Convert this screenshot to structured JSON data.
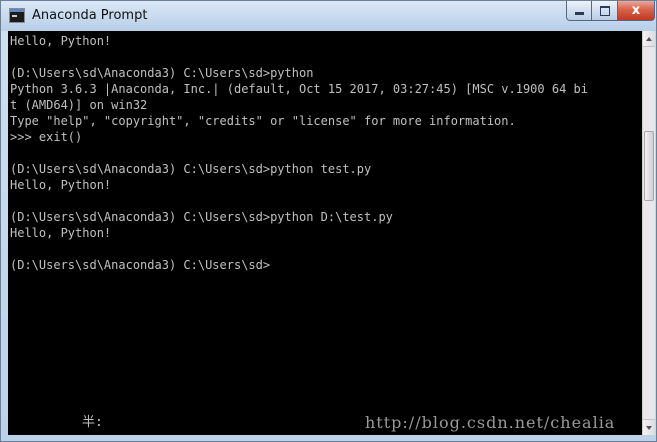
{
  "window": {
    "title": "Anaconda Prompt",
    "controls": {
      "minimize": "minimize",
      "maximize": "maximize",
      "close": "x"
    }
  },
  "console": {
    "lines": [
      "Hello, Python!",
      "",
      "(D:\\Users\\sd\\Anaconda3) C:\\Users\\sd>python",
      "Python 3.6.3 |Anaconda, Inc.| (default, Oct 15 2017, 03:27:45) [MSC v.1900 64 bi",
      "t (AMD64)] on win32",
      "Type \"help\", \"copyright\", \"credits\" or \"license\" for more information.",
      ">>> exit()",
      "",
      "(D:\\Users\\sd\\Anaconda3) C:\\Users\\sd>python test.py",
      "Hello, Python!",
      "",
      "(D:\\Users\\sd\\Anaconda3) C:\\Users\\sd>python D:\\test.py",
      "Hello, Python!",
      "",
      "(D:\\Users\\sd\\Anaconda3) C:\\Users\\sd>"
    ],
    "ime_status": "半:",
    "watermark": "http://blog.csdn.net/chealia"
  },
  "colors": {
    "console_background": "#000000",
    "console_text": "#c0c0c0",
    "titlebar": "#c6d9ee",
    "close_button": "#c1381f"
  },
  "icons": {
    "app": "terminal-icon",
    "minimize": "minimize-icon",
    "maximize": "maximize-icon",
    "close": "close-icon"
  }
}
